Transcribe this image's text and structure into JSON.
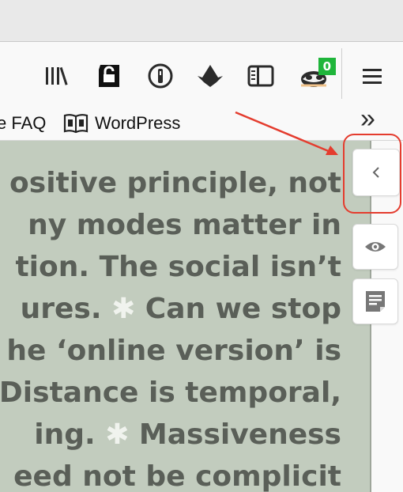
{
  "browser": {
    "toolbar_icons": [
      {
        "name": "library-icon",
        "glyph": "𝄃𝄃\\"
      },
      {
        "name": "extension-lock-icon",
        "glyph": "🔓"
      },
      {
        "name": "password-manager-icon",
        "glyph": "ⓘ"
      },
      {
        "name": "bird-extension-icon",
        "glyph": "▲"
      },
      {
        "name": "sidebar-icon",
        "glyph": "▯"
      },
      {
        "name": "badger-extension-icon",
        "glyph": "🦡"
      }
    ],
    "badge_count": "0",
    "menu_glyph": "☰",
    "accent_badge": "#1fb53b"
  },
  "bookmarks": {
    "items": [
      {
        "label": "e FAQ"
      },
      {
        "label": "WordPress"
      }
    ],
    "overflow_glyph": "»"
  },
  "page_text": {
    "lines": [
      {
        "before": "ositive principle, not",
        "after": ""
      },
      {
        "before": "ny modes matter in",
        "after": ""
      },
      {
        "before": "tion. The social isn’t",
        "after": ""
      },
      {
        "before": "ures. ",
        "star": "✱",
        "after": " Can we stop"
      },
      {
        "before": "he ‘online version’ is",
        "after": ""
      },
      {
        "before": "Distance is temporal,",
        "after": ""
      },
      {
        "before": "ing. ",
        "star": "✱",
        "after": " Massiveness"
      },
      {
        "before": "eed not be complicit",
        "after": ""
      }
    ]
  },
  "sidebar_buttons": {
    "collapse_glyph": "‹",
    "view_glyph": "◉",
    "notes_glyph": "≣"
  },
  "annotation": {
    "arrow_color": "#e43c2e"
  }
}
